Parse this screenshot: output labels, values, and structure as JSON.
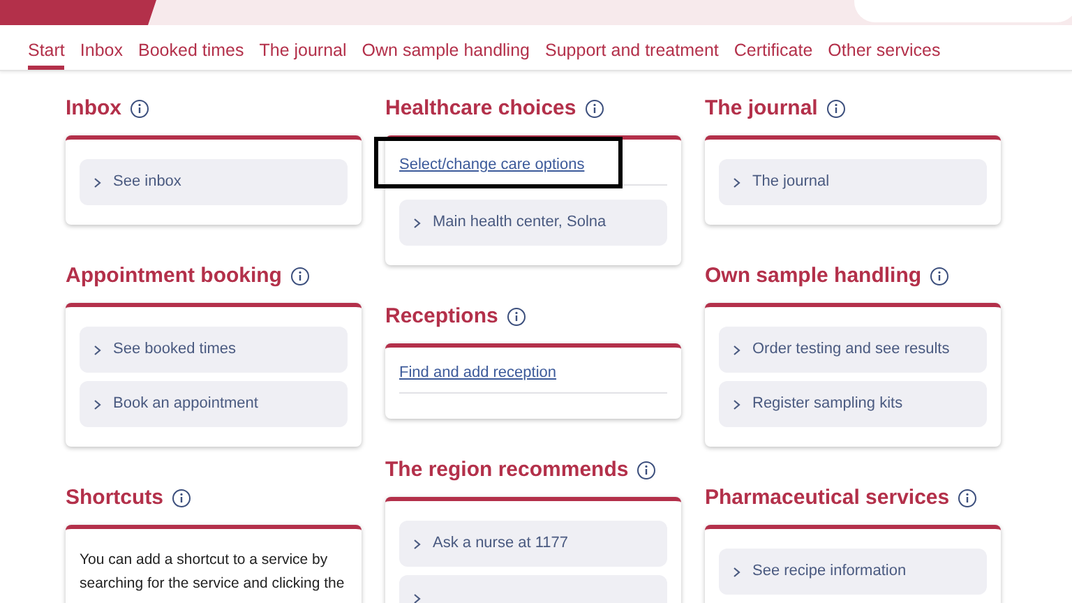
{
  "header": {
    "search": {
      "kind": "pill"
    }
  },
  "nav": [
    {
      "label": "Start",
      "selected": true
    },
    {
      "label": "Inbox",
      "selected": false
    },
    {
      "label": "Booked times",
      "selected": false
    },
    {
      "label": "The journal",
      "selected": false
    },
    {
      "label": "Own sample handling",
      "selected": false
    },
    {
      "label": "Support and treatment",
      "selected": false
    },
    {
      "label": "Certificate",
      "selected": false
    },
    {
      "label": "Other services",
      "selected": false
    }
  ],
  "columns": [
    [
      {
        "title": "Inbox",
        "items": [
          {
            "kind": "tile",
            "label": "See inbox"
          }
        ]
      },
      {
        "title": "Appointment booking",
        "items": [
          {
            "kind": "tile",
            "label": "See booked times"
          },
          {
            "kind": "tile",
            "label": "Book an appointment"
          }
        ]
      },
      {
        "title": "Shortcuts",
        "items": [
          {
            "kind": "text",
            "label": "You can add a shortcut to a service by searching for the service and clicking the"
          }
        ]
      }
    ],
    [
      {
        "title": "Healthcare choices",
        "items": [
          {
            "kind": "link",
            "label": "Select/change care options",
            "highlighted": true
          },
          {
            "kind": "tile",
            "label": "Main health center, Solna"
          }
        ]
      },
      {
        "title": "Receptions",
        "items": [
          {
            "kind": "link",
            "label": "Find and add reception",
            "highlighted": false
          }
        ]
      },
      {
        "title": "The region recommends",
        "items": [
          {
            "kind": "tile",
            "label": "Ask a nurse at 1177"
          },
          {
            "kind": "tile"
          }
        ]
      }
    ],
    [
      {
        "title": "The journal",
        "items": [
          {
            "kind": "tile",
            "label": "The journal"
          }
        ]
      },
      {
        "title": "Own sample handling",
        "items": [
          {
            "kind": "tile",
            "label": "Order testing and see results"
          },
          {
            "kind": "tile",
            "label": "Register sampling kits"
          }
        ]
      },
      {
        "title": "Pharmaceutical services",
        "items": [
          {
            "kind": "tile",
            "label": "See recipe information"
          }
        ]
      }
    ]
  ]
}
